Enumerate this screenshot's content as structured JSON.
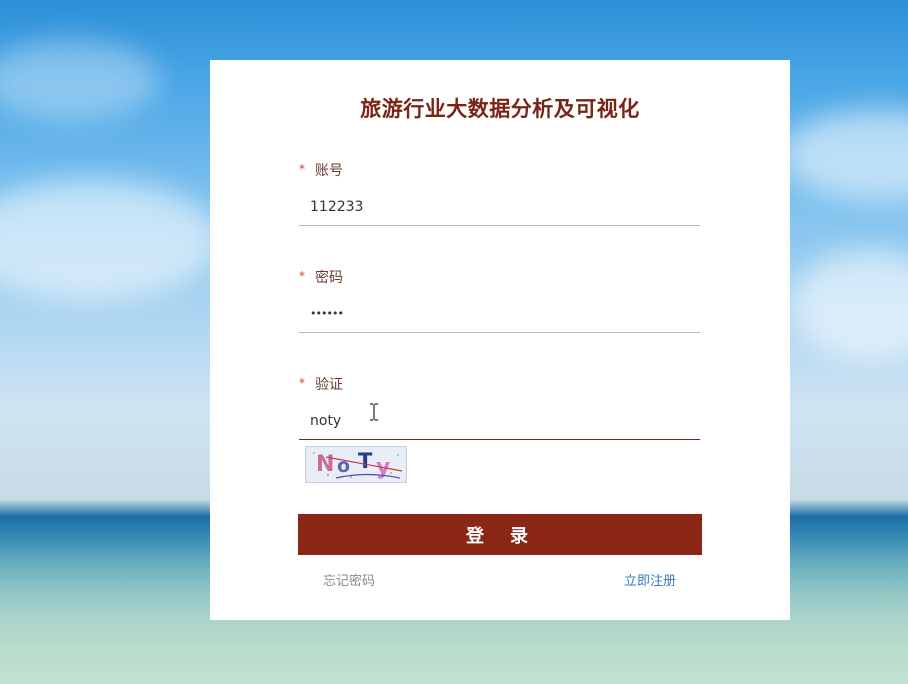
{
  "app": {
    "title": "旅游行业大数据分析及可视化"
  },
  "form": {
    "account": {
      "label": "账号",
      "required_mark": "*",
      "value": "112233"
    },
    "password": {
      "label": "密码",
      "required_mark": "*",
      "value": "••••••"
    },
    "verify": {
      "label": "验证",
      "required_mark": "*",
      "value": "noty"
    },
    "captcha": {
      "chars": [
        "N",
        "o",
        "T",
        "y"
      ],
      "colors": [
        "#c66f9a",
        "#5a63b8",
        "#2d3a8a",
        "#d778c9"
      ]
    },
    "login_label": "登录",
    "forgot_label": "忘记密码",
    "register_label": "立即注册"
  },
  "colors": {
    "brand": "#8b2616",
    "title": "#7a2416",
    "required": "#d43c2c",
    "link": "#3a78c2"
  }
}
